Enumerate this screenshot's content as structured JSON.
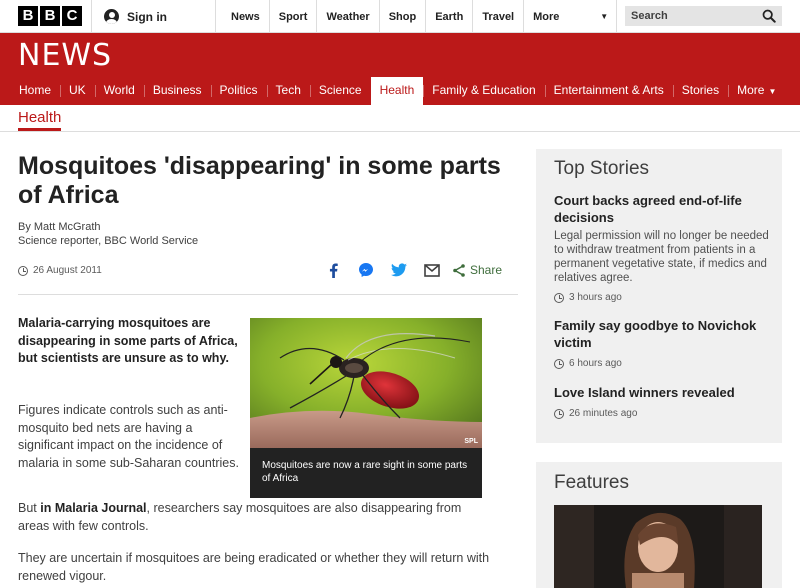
{
  "topbar": {
    "logo_letters": [
      "B",
      "B",
      "C"
    ],
    "signin_label": "Sign in",
    "nav": [
      "News",
      "Sport",
      "Weather",
      "Shop",
      "Earth",
      "Travel"
    ],
    "more_label": "More",
    "search_placeholder": "Search"
  },
  "news": {
    "title": "NEWS",
    "nav": [
      "Home",
      "UK",
      "World",
      "Business",
      "Politics",
      "Tech",
      "Science",
      "Health",
      "Family & Education",
      "Entertainment & Arts",
      "Stories"
    ],
    "active": "Health",
    "more_label": "More"
  },
  "section": "Health",
  "article": {
    "headline": "Mosquitoes 'disappearing' in some parts of Africa",
    "author": "By Matt McGrath",
    "role": "Science reporter, BBC World Service",
    "date": "26 August 2011",
    "share_label": "Share",
    "lead": "Malaria-carrying mosquitoes are disappearing in some parts of Africa, but scientists are unsure as to why.",
    "para1": "Figures indicate controls such as anti-mosquito bed nets are having a significant impact on the incidence of malaria in some sub-Saharan countries.",
    "para2_prefix": "But ",
    "para2_link": "in Malaria Journal",
    "para2_rest": ", researchers say mosquitoes are also disappearing from areas with few controls.",
    "para3": "They are uncertain if mosquitoes are being eradicated or whether they will return with renewed vigour.",
    "image_credit": "SPL",
    "caption": "Mosquitoes are now a rare sight in some parts of Africa"
  },
  "sidebar": {
    "top_stories_title": "Top Stories",
    "stories": [
      {
        "title": "Court backs agreed end-of-life decisions",
        "desc": "Legal permission will no longer be needed to withdraw treatment from patients in a permanent vegetative state, if medics and relatives agree.",
        "time": "3 hours ago"
      },
      {
        "title": "Family say goodbye to Novichok victim",
        "desc": "",
        "time": "6 hours ago"
      },
      {
        "title": "Love Island winners revealed",
        "desc": "",
        "time": "26 minutes ago"
      }
    ],
    "features_title": "Features"
  }
}
